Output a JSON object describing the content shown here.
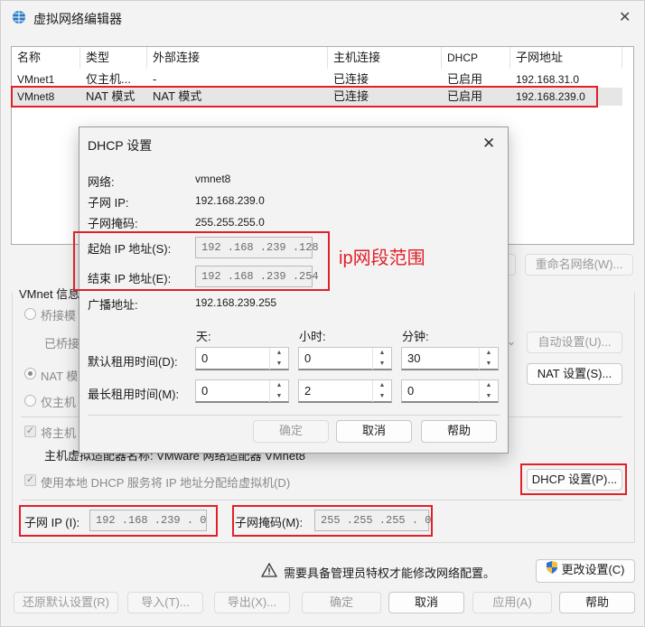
{
  "window": {
    "title": "虚拟网络编辑器",
    "close": "✕"
  },
  "table": {
    "headers": [
      "名称",
      "类型",
      "外部连接",
      "主机连接",
      "DHCP",
      "子网地址"
    ],
    "rows": [
      [
        "VMnet1",
        "仅主机...",
        "-",
        "已连接",
        "已启用",
        "192.168.31.0"
      ],
      [
        "VMnet8",
        "NAT 模式",
        "NAT 模式",
        "已连接",
        "已启用",
        "192.168.239.0"
      ]
    ]
  },
  "main": {
    "rename_network": "重命名网络(W)...",
    "vmnet_info": "VMnet 信息",
    "bridged": "桥接模",
    "bridged_to": "已桥接",
    "auto_settings": "自动设置(U)...",
    "nat": "NAT 模",
    "nat_settings": "NAT 设置(S)...",
    "host_only": "仅主机",
    "connect_host": "将主机",
    "host_adapter_name": "主机虚拟适配器名称: VMware 网络适配器 VMnet8",
    "use_dhcp": "使用本地 DHCP 服务将 IP 地址分配给虚拟机(D)",
    "dhcp_settings": "DHCP 设置(P)...",
    "subnet_ip_label": "子网 IP (I):",
    "subnet_ip": "192 .168 .239 . 0",
    "subnet_mask_label": "子网掩码(M):",
    "subnet_mask": "255 .255 .255 . 0",
    "admin_notice": "需要具备管理员特权才能修改网络配置。",
    "change_settings": "更改设置(C)"
  },
  "footer": {
    "restore": "还原默认设置(R)",
    "import": "导入(T)...",
    "export": "导出(X)...",
    "ok": "确定",
    "cancel": "取消",
    "apply": "应用(A)",
    "help": "帮助"
  },
  "dialog": {
    "title": "DHCP 设置",
    "close": "✕",
    "network_label": "网络:",
    "network_value": "vmnet8",
    "subnet_ip_label": "子网 IP:",
    "subnet_ip_value": "192.168.239.0",
    "subnet_mask_label": "子网掩码:",
    "subnet_mask_value": "255.255.255.0",
    "start_ip_label": "起始 IP 地址(S):",
    "start_ip": "192 .168 .239 .128",
    "end_ip_label": "结束 IP 地址(E):",
    "end_ip": "192 .168 .239 .254",
    "broadcast_label": "广播地址:",
    "broadcast_value": "192.168.239.255",
    "col_days": "天:",
    "col_hours": "小时:",
    "col_minutes": "分钟:",
    "default_lease_label": "默认租用时间(D):",
    "default_lease": [
      "0",
      "0",
      "30"
    ],
    "max_lease_label": "最长租用时间(M):",
    "max_lease": [
      "0",
      "2",
      "0"
    ],
    "ok": "确定",
    "cancel": "取消",
    "help": "帮助"
  },
  "annotation": {
    "text": "ip网段范围",
    "color": "#e0202a"
  }
}
